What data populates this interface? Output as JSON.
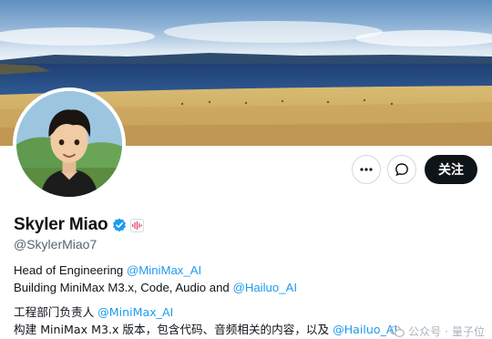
{
  "profile": {
    "display_name": "Skyler Miao",
    "handle": "@SkylerMiao7",
    "verified": true
  },
  "actions": {
    "more_icon": "more-dots-icon",
    "message_icon": "message-icon",
    "follow_label": "关注"
  },
  "bio": {
    "line1_text": "Head of Engineering ",
    "line1_mention": "@MiniMax_AI",
    "line2_text": "Building MiniMax M3.x, Code, Audio and ",
    "line2_mention": "@Hailuo_AI",
    "line3_text": "工程部门负责人 ",
    "line3_mention": "@MiniMax_AI",
    "line4_text": "构建 MiniMax M3.x 版本，包含代码、音频相关的内容，以及 ",
    "line4_mention": "@Hailuo_AI"
  },
  "watermark": {
    "source": "公众号",
    "sep": "·",
    "brand": "量子位"
  },
  "colors": {
    "accent": "#1d9bf0",
    "text": "#0f1419",
    "muted": "#536471",
    "follow_bg": "#0f1419"
  }
}
